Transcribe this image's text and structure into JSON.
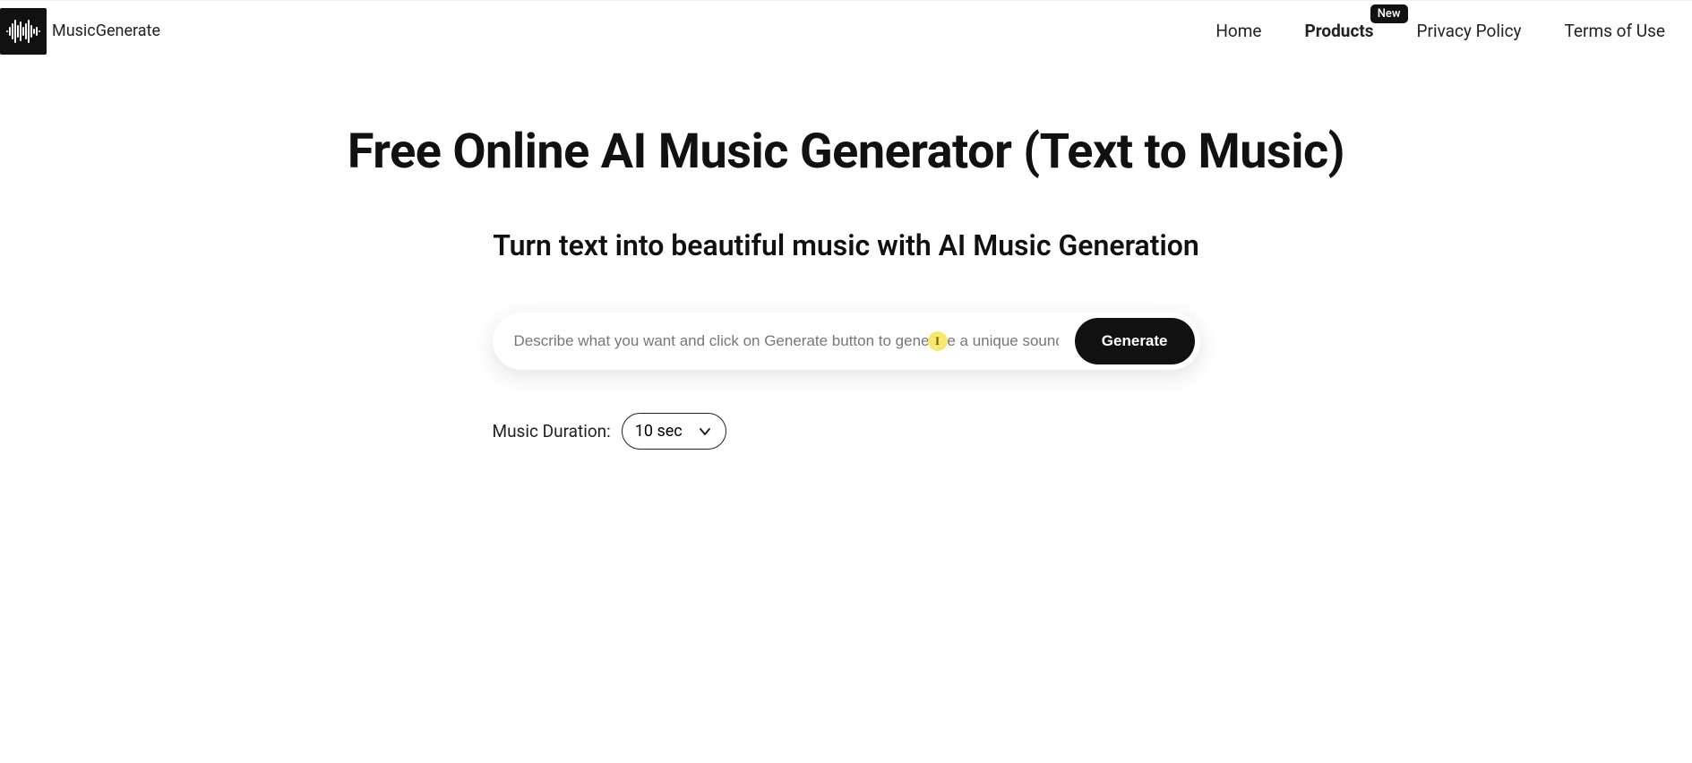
{
  "brand": {
    "name": "MusicGenerate"
  },
  "nav": {
    "items": [
      {
        "label": "Home",
        "active": false
      },
      {
        "label": "Products",
        "active": true,
        "badge": "New"
      },
      {
        "label": "Privacy Policy",
        "active": false
      },
      {
        "label": "Terms of Use",
        "active": false
      }
    ]
  },
  "main": {
    "title": "Free Online AI Music Generator (Text to Music)",
    "subtitle": "Turn text into beautiful music with AI Music Generation",
    "prompt_placeholder": "Describe what you want and click on Generate button to generate a unique soundtrack.",
    "prompt_value": "",
    "generate_label": "Generate",
    "duration_label": "Music Duration:",
    "duration_value": "10 sec",
    "cursor_glyph": "I"
  }
}
